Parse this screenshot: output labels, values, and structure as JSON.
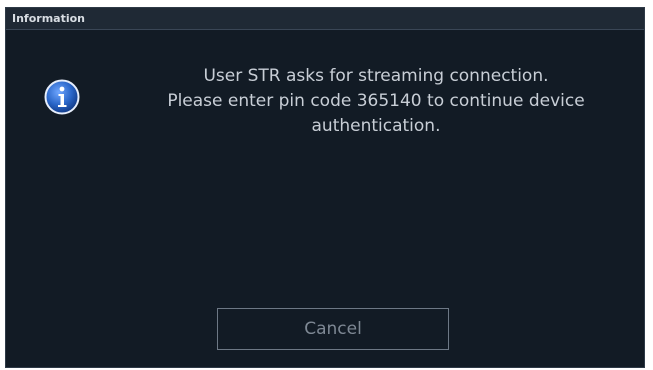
{
  "dialog": {
    "title": "Information",
    "icon": "info-icon",
    "message_lines": [
      "User STR asks for streaming connection.",
      "Please enter pin code 365140 to continue device",
      "authentication."
    ],
    "cancel_label": "Cancel"
  },
  "colors": {
    "background": "#121b25",
    "titlebar": "#1f2935",
    "text": "#c8ced6",
    "icon_blue": "#2a66c8"
  }
}
